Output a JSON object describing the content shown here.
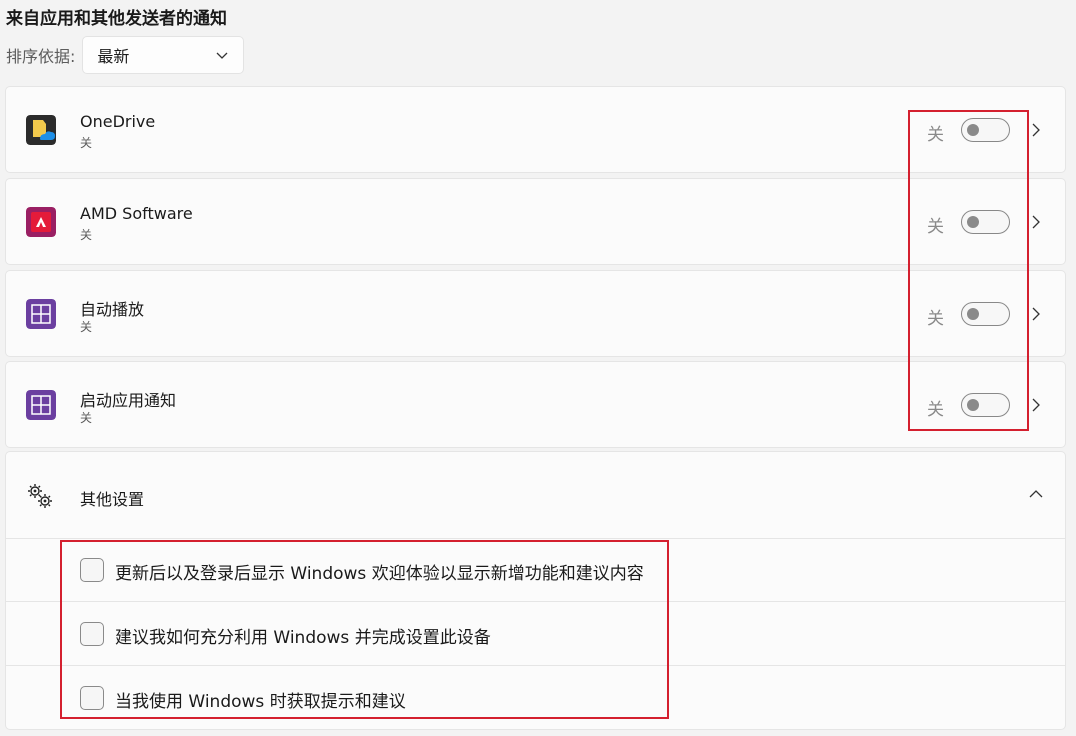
{
  "section_title": "来自应用和其他发送者的通知",
  "sort": {
    "label": "排序依据:",
    "value": "最新"
  },
  "apps": [
    {
      "name": "OneDrive",
      "status": "关",
      "toggle_label": "关",
      "icon": "onedrive-icon"
    },
    {
      "name": "AMD Software",
      "status": "关",
      "toggle_label": "关",
      "icon": "amd-icon"
    },
    {
      "name": "自动播放",
      "status": "关",
      "toggle_label": "关",
      "icon": "autoplay-icon"
    },
    {
      "name": "启动应用通知",
      "status": "关",
      "toggle_label": "关",
      "icon": "startup-apps-icon"
    }
  ],
  "other_settings": {
    "title": "其他设置",
    "options": [
      {
        "label": "更新后以及登录后显示 Windows 欢迎体验以显示新增功能和建议内容",
        "checked": false
      },
      {
        "label": "建议我如何充分利用 Windows 并完成设置此设备",
        "checked": false
      },
      {
        "label": "当我使用 Windows 时获取提示和建议",
        "checked": false
      }
    ]
  },
  "colors": {
    "highlight": "#d4202f",
    "amd": "#c8102e",
    "tile_purple": "#6b3fa0"
  }
}
